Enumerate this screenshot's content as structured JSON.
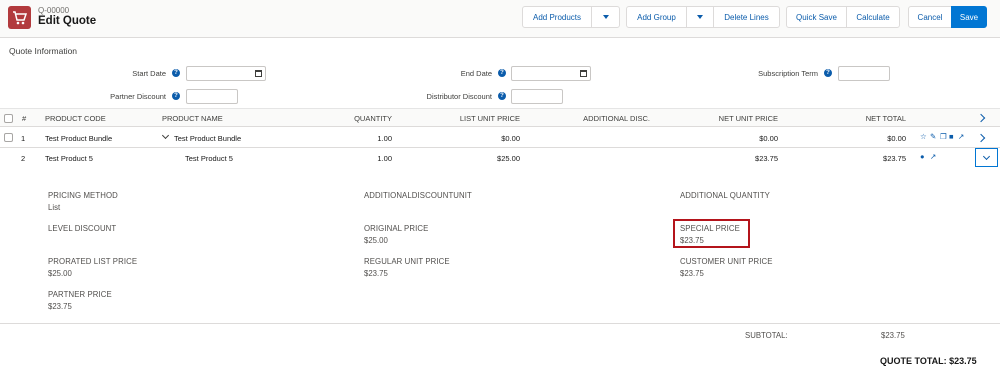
{
  "header": {
    "quote_number": "Q-00000",
    "title": "Edit Quote",
    "buttons": {
      "add_products": "Add Products",
      "add_group": "Add Group",
      "delete_lines": "Delete Lines",
      "quick_save": "Quick Save",
      "calculate": "Calculate",
      "cancel": "Cancel",
      "save": "Save"
    }
  },
  "quote_info": {
    "title": "Quote Information",
    "fields": {
      "start_date": {
        "label": "Start Date",
        "value": ""
      },
      "end_date": {
        "label": "End Date",
        "value": ""
      },
      "subscription_term": {
        "label": "Subscription Term",
        "value": ""
      },
      "partner_discount": {
        "label": "Partner Discount",
        "value": ""
      },
      "distributor_discount": {
        "label": "Distributor Discount",
        "value": ""
      }
    },
    "help_glyph": "?"
  },
  "table": {
    "columns": {
      "num": "#",
      "product_code": "PRODUCT CODE",
      "product_name": "PRODUCT NAME",
      "quantity": "QUANTITY",
      "list_unit_price": "LIST UNIT PRICE",
      "additional_disc": "ADDITIONAL DISC.",
      "net_unit_price": "NET UNIT PRICE",
      "net_total": "NET TOTAL"
    },
    "rows": [
      {
        "num": "1",
        "product_code": "Test Product Bundle",
        "product_name": "Test Product Bundle",
        "quantity": "1.00",
        "list_unit_price": "$0.00",
        "additional_disc": "",
        "net_unit_price": "$0.00",
        "net_total": "$0.00"
      },
      {
        "num": "2",
        "product_code": "Test Product 5",
        "product_name": "Test Product 5",
        "quantity": "1.00",
        "list_unit_price": "$25.00",
        "additional_disc": "",
        "net_unit_price": "$23.75",
        "net_total": "$23.75"
      }
    ]
  },
  "details": {
    "pricing_method": {
      "label": "PRICING METHOD",
      "value": "List"
    },
    "additional_discount_unit": {
      "label": "ADDITIONALDISCOUNTUNIT",
      "value": ""
    },
    "additional_quantity": {
      "label": "ADDITIONAL QUANTITY",
      "value": ""
    },
    "level_discount": {
      "label": "LEVEL DISCOUNT",
      "value": ""
    },
    "original_price": {
      "label": "ORIGINAL PRICE",
      "value": "$25.00"
    },
    "special_price": {
      "label": "SPECIAL PRICE",
      "value": "$23.75"
    },
    "prorated_list_price": {
      "label": "PRORATED LIST PRICE",
      "value": "$25.00"
    },
    "regular_unit_price": {
      "label": "REGULAR UNIT PRICE",
      "value": "$23.75"
    },
    "customer_unit_price": {
      "label": "CUSTOMER UNIT PRICE",
      "value": "$23.75"
    },
    "partner_price": {
      "label": "PARTNER PRICE",
      "value": "$23.75"
    }
  },
  "totals": {
    "subtotal_label": "SUBTOTAL:",
    "subtotal_value": "$23.75",
    "quote_total": "QUOTE TOTAL: $23.75"
  },
  "colors": {
    "brand": "#0176d3",
    "link": "#0b5cab",
    "app_icon": "#b23a3d",
    "highlight_box": "#b4141b"
  }
}
